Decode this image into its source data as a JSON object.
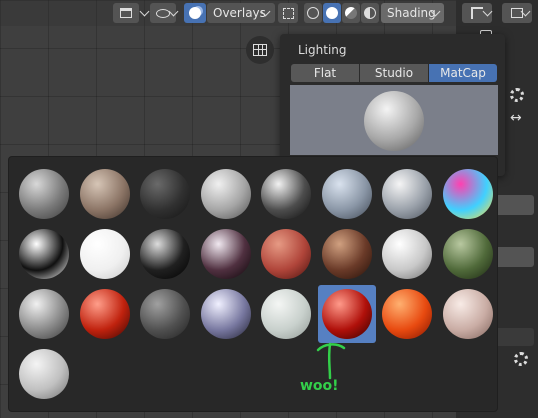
{
  "header": {
    "overlays_label": "Overlays",
    "shading_label": "Shading"
  },
  "lighting": {
    "title": "Lighting",
    "modes": [
      "Flat",
      "Studio",
      "MatCap"
    ],
    "active_mode": "MatCap"
  },
  "matcaps": [
    {
      "name": "basic_1",
      "colors": [
        "#d8d8d8",
        "#7a7a7a",
        "#3a3a3a"
      ]
    },
    {
      "name": "basic_2",
      "colors": [
        "#d6c5b6",
        "#8c7566",
        "#3a2e27"
      ]
    },
    {
      "name": "basic_dark",
      "colors": [
        "#6a6a6a",
        "#303030",
        "#141414"
      ]
    },
    {
      "name": "basic_side",
      "colors": [
        "#f0f0f0",
        "#a5a5a5",
        "#505050"
      ]
    },
    {
      "name": "ceramic_dark",
      "colors": [
        "#f2f2f2",
        "#4d4d4d",
        "#0e0e0e"
      ]
    },
    {
      "name": "ceramic_lightbulb",
      "colors": [
        "#d9e2ee",
        "#8a96a6",
        "#3f4753"
      ]
    },
    {
      "name": "check_normal_y",
      "colors": [
        "#f5f5f5",
        "#9aa1aa",
        "#4b525c"
      ]
    },
    {
      "name": "check_rim_dark",
      "colors": [
        "#ff40b0",
        "#40d0ff",
        "#ffe040"
      ]
    },
    {
      "name": "check_rim_light",
      "colors": [
        "#ffffff",
        "#101010",
        "#ffffff"
      ]
    },
    {
      "name": "clay_brown",
      "colors": [
        "#ffffff",
        "#f0f0f0",
        "#c8c8c8"
      ]
    },
    {
      "name": "clay_muddy",
      "colors": [
        "#dcdcdc",
        "#202020",
        "#000000"
      ]
    },
    {
      "name": "clay_studio",
      "colors": [
        "#f0e8f0",
        "#503040",
        "#0c0508"
      ]
    },
    {
      "name": "jade",
      "colors": [
        "#e69a84",
        "#b0453a",
        "#4a120e"
      ]
    },
    {
      "name": "metal_anisotropic",
      "colors": [
        "#d0a080",
        "#6a3a28",
        "#241008"
      ]
    },
    {
      "name": "metal_carpaint",
      "colors": [
        "#ffffff",
        "#c8c8c8",
        "#6e6e6e"
      ]
    },
    {
      "name": "metal_lead",
      "colors": [
        "#b8c8a0",
        "#506a3a",
        "#1a2610"
      ]
    },
    {
      "name": "metal_shiny",
      "colors": [
        "#f0f0f0",
        "#8a8a8a",
        "#383838"
      ]
    },
    {
      "name": "pearl",
      "colors": [
        "#ff9e8a",
        "#c0220e",
        "#3a0602"
      ]
    },
    {
      "name": "reflection_check_horizontal",
      "colors": [
        "#a0a0a0",
        "#505050",
        "#202020"
      ]
    },
    {
      "name": "reflection_check_vertical",
      "colors": [
        "#f0f0ff",
        "#7878a0",
        "#202030"
      ]
    },
    {
      "name": "resin",
      "colors": [
        "#f4f6f4",
        "#c8d0cc",
        "#909894"
      ]
    },
    {
      "name": "skin",
      "colors": [
        "#ff9a8a",
        "#b0100a",
        "#300000"
      ]
    },
    {
      "name": "toon",
      "colors": [
        "#ffb070",
        "#e84a10",
        "#801400"
      ]
    },
    {
      "name": "toon_2",
      "colors": [
        "#f8ebe6",
        "#c9aca4",
        "#7e625a"
      ]
    },
    {
      "name": "default",
      "colors": [
        "#f4f4f4",
        "#c0c0c0",
        "#707070"
      ]
    }
  ],
  "selected_matcap_index": 21,
  "annotation": {
    "text": "woo!",
    "color": "#33d04a"
  }
}
